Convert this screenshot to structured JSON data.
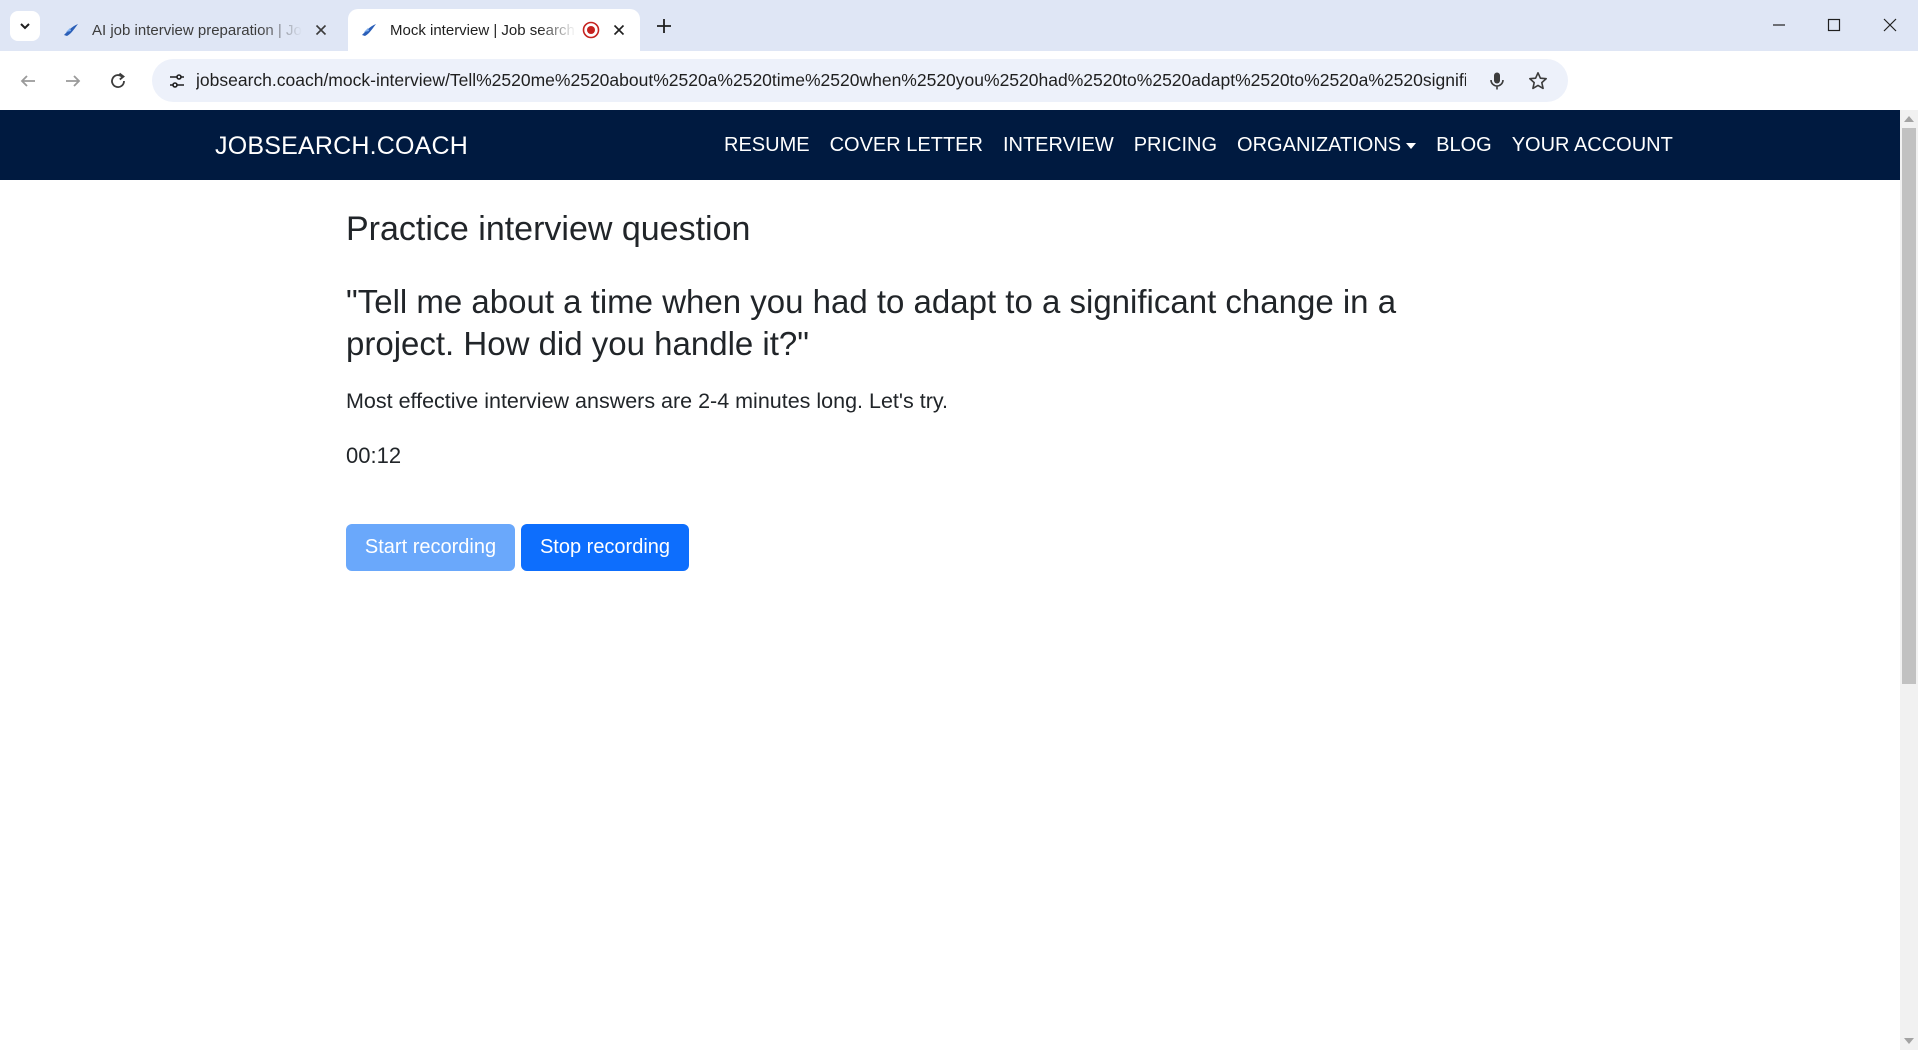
{
  "browser": {
    "tabs": [
      {
        "title": "AI job interview preparation | Job search coach",
        "active": false
      },
      {
        "title": "Mock interview | Job search coach",
        "active": true,
        "recording": true
      }
    ],
    "url": "jobsearch.coach/mock-interview/Tell%2520me%2520about%2520a%2520time%2520when%2520you%2520had%2520to%2520adapt%2520to%2520a%2520significa..."
  },
  "site": {
    "brand": "JOBSEARCH.COACH",
    "nav": [
      {
        "label": "RESUME"
      },
      {
        "label": "COVER LETTER"
      },
      {
        "label": "INTERVIEW"
      },
      {
        "label": "PRICING"
      },
      {
        "label": "ORGANIZATIONS",
        "dropdown": true
      },
      {
        "label": "BLOG"
      },
      {
        "label": "YOUR ACCOUNT"
      }
    ],
    "colors": {
      "navbar_bg": "#001a40",
      "primary": "#0d6efd",
      "primary_disabled": "#6aa8fb"
    }
  },
  "main": {
    "title": "Practice interview question",
    "question": "\"Tell me about a time when you had to adapt to a significant change in a project. How did you handle it?\"",
    "hint": "Most effective interview answers are 2-4 minutes long. Let's try.",
    "timer": "00:12",
    "start_label": "Start recording",
    "stop_label": "Stop recording"
  }
}
